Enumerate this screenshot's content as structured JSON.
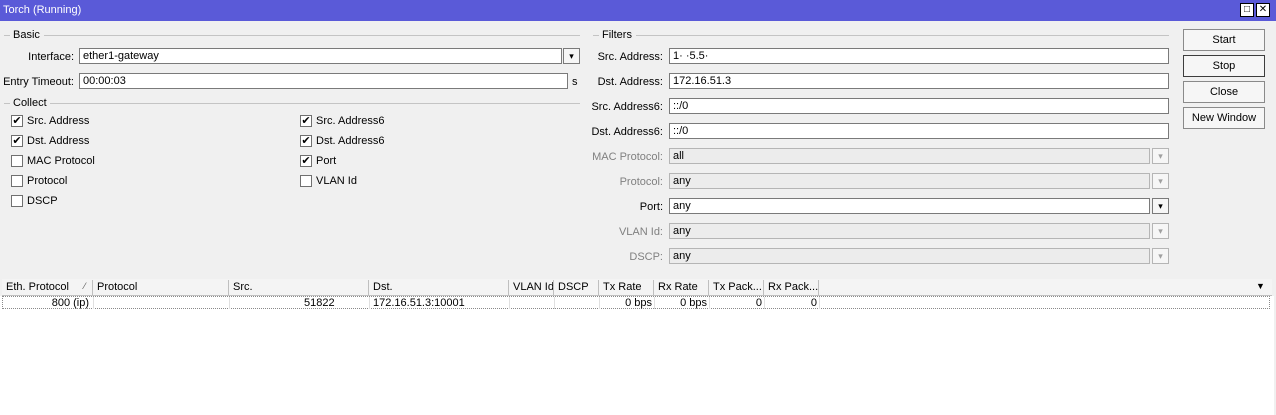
{
  "window": {
    "title": "Torch (Running)",
    "maximize_glyph": "□",
    "close_glyph": "✕"
  },
  "basic": {
    "group_label": "Basic",
    "interface_label": "Interface:",
    "interface_value": "ether1-gateway",
    "entry_timeout_label": "Entry Timeout:",
    "entry_timeout_value": "00:00:03",
    "entry_timeout_unit": "s"
  },
  "collect": {
    "group_label": "Collect",
    "items": [
      {
        "label": "Src. Address",
        "checked": true,
        "mark": "✔"
      },
      {
        "label": "Dst. Address",
        "checked": true,
        "mark": "✔"
      },
      {
        "label": "MAC Protocol",
        "checked": false,
        "mark": ""
      },
      {
        "label": "Protocol",
        "checked": false,
        "mark": ""
      },
      {
        "label": "DSCP",
        "checked": false,
        "mark": ""
      },
      {
        "label": "Src. Address6",
        "checked": true,
        "mark": "✔"
      },
      {
        "label": "Dst. Address6",
        "checked": true,
        "mark": "✔"
      },
      {
        "label": "Port",
        "checked": true,
        "mark": "✔"
      },
      {
        "label": "VLAN Id",
        "checked": false,
        "mark": ""
      }
    ]
  },
  "filters": {
    "group_label": "Filters",
    "src_address_label": "Src. Address:",
    "src_address_value": "1·       ·5.5·",
    "dst_address_label": "Dst. Address:",
    "dst_address_value": "172.16.51.3",
    "src_address6_label": "Src. Address6:",
    "src_address6_value": "::/0",
    "dst_address6_label": "Dst. Address6:",
    "dst_address6_value": "::/0",
    "mac_protocol_label": "MAC Protocol:",
    "mac_protocol_value": "all",
    "protocol_label": "Protocol:",
    "protocol_value": "any",
    "port_label": "Port:",
    "port_value": "any",
    "vlan_id_label": "VLAN Id:",
    "vlan_id_value": "any",
    "dscp_label": "DSCP:",
    "dscp_value": "any"
  },
  "buttons": {
    "start": "Start",
    "stop": "Stop",
    "close": "Close",
    "new_window": "New Window"
  },
  "table": {
    "columns": [
      "Eth. Protocol",
      "Protocol",
      "Src.",
      "Dst.",
      "VLAN Id",
      "DSCP",
      "Tx Rate",
      "Rx Rate",
      "Tx Pack...",
      "Rx Pack..."
    ],
    "sort_glyph": "⁄",
    "menu_glyph": "▼",
    "rows": [
      {
        "eth_protocol": "800 (ip)",
        "protocol": "",
        "src": "51822",
        "dst": "172.16.51.3:10001",
        "vlan_id": "",
        "dscp": "",
        "tx_rate": "0 bps",
        "rx_rate": "0 bps",
        "tx_packets": "0",
        "rx_packets": "0"
      }
    ]
  },
  "icons": {
    "dropdown": "dropdown-arrow-icon",
    "checkbox_mark": "checkmark-icon"
  }
}
